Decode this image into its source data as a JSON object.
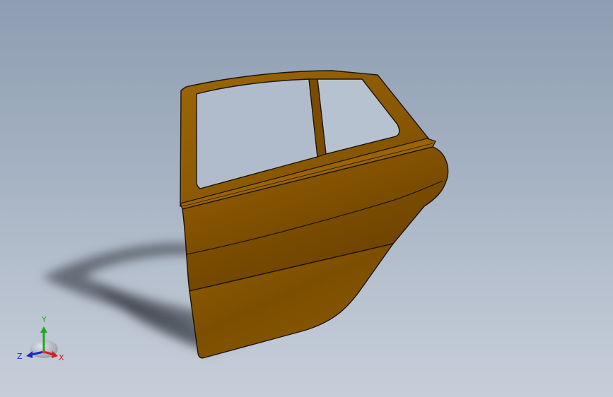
{
  "viewport": {
    "background_top": "#8e9db2",
    "background_bottom": "#c6ced9"
  },
  "model": {
    "name": "rear-car-door",
    "color": "#8c5a00"
  },
  "triad": {
    "x_label": "X",
    "y_label": "Y",
    "z_label": "Z",
    "x_color": "#d21e1e",
    "y_color": "#1ea81e",
    "z_color": "#1e28c8"
  }
}
